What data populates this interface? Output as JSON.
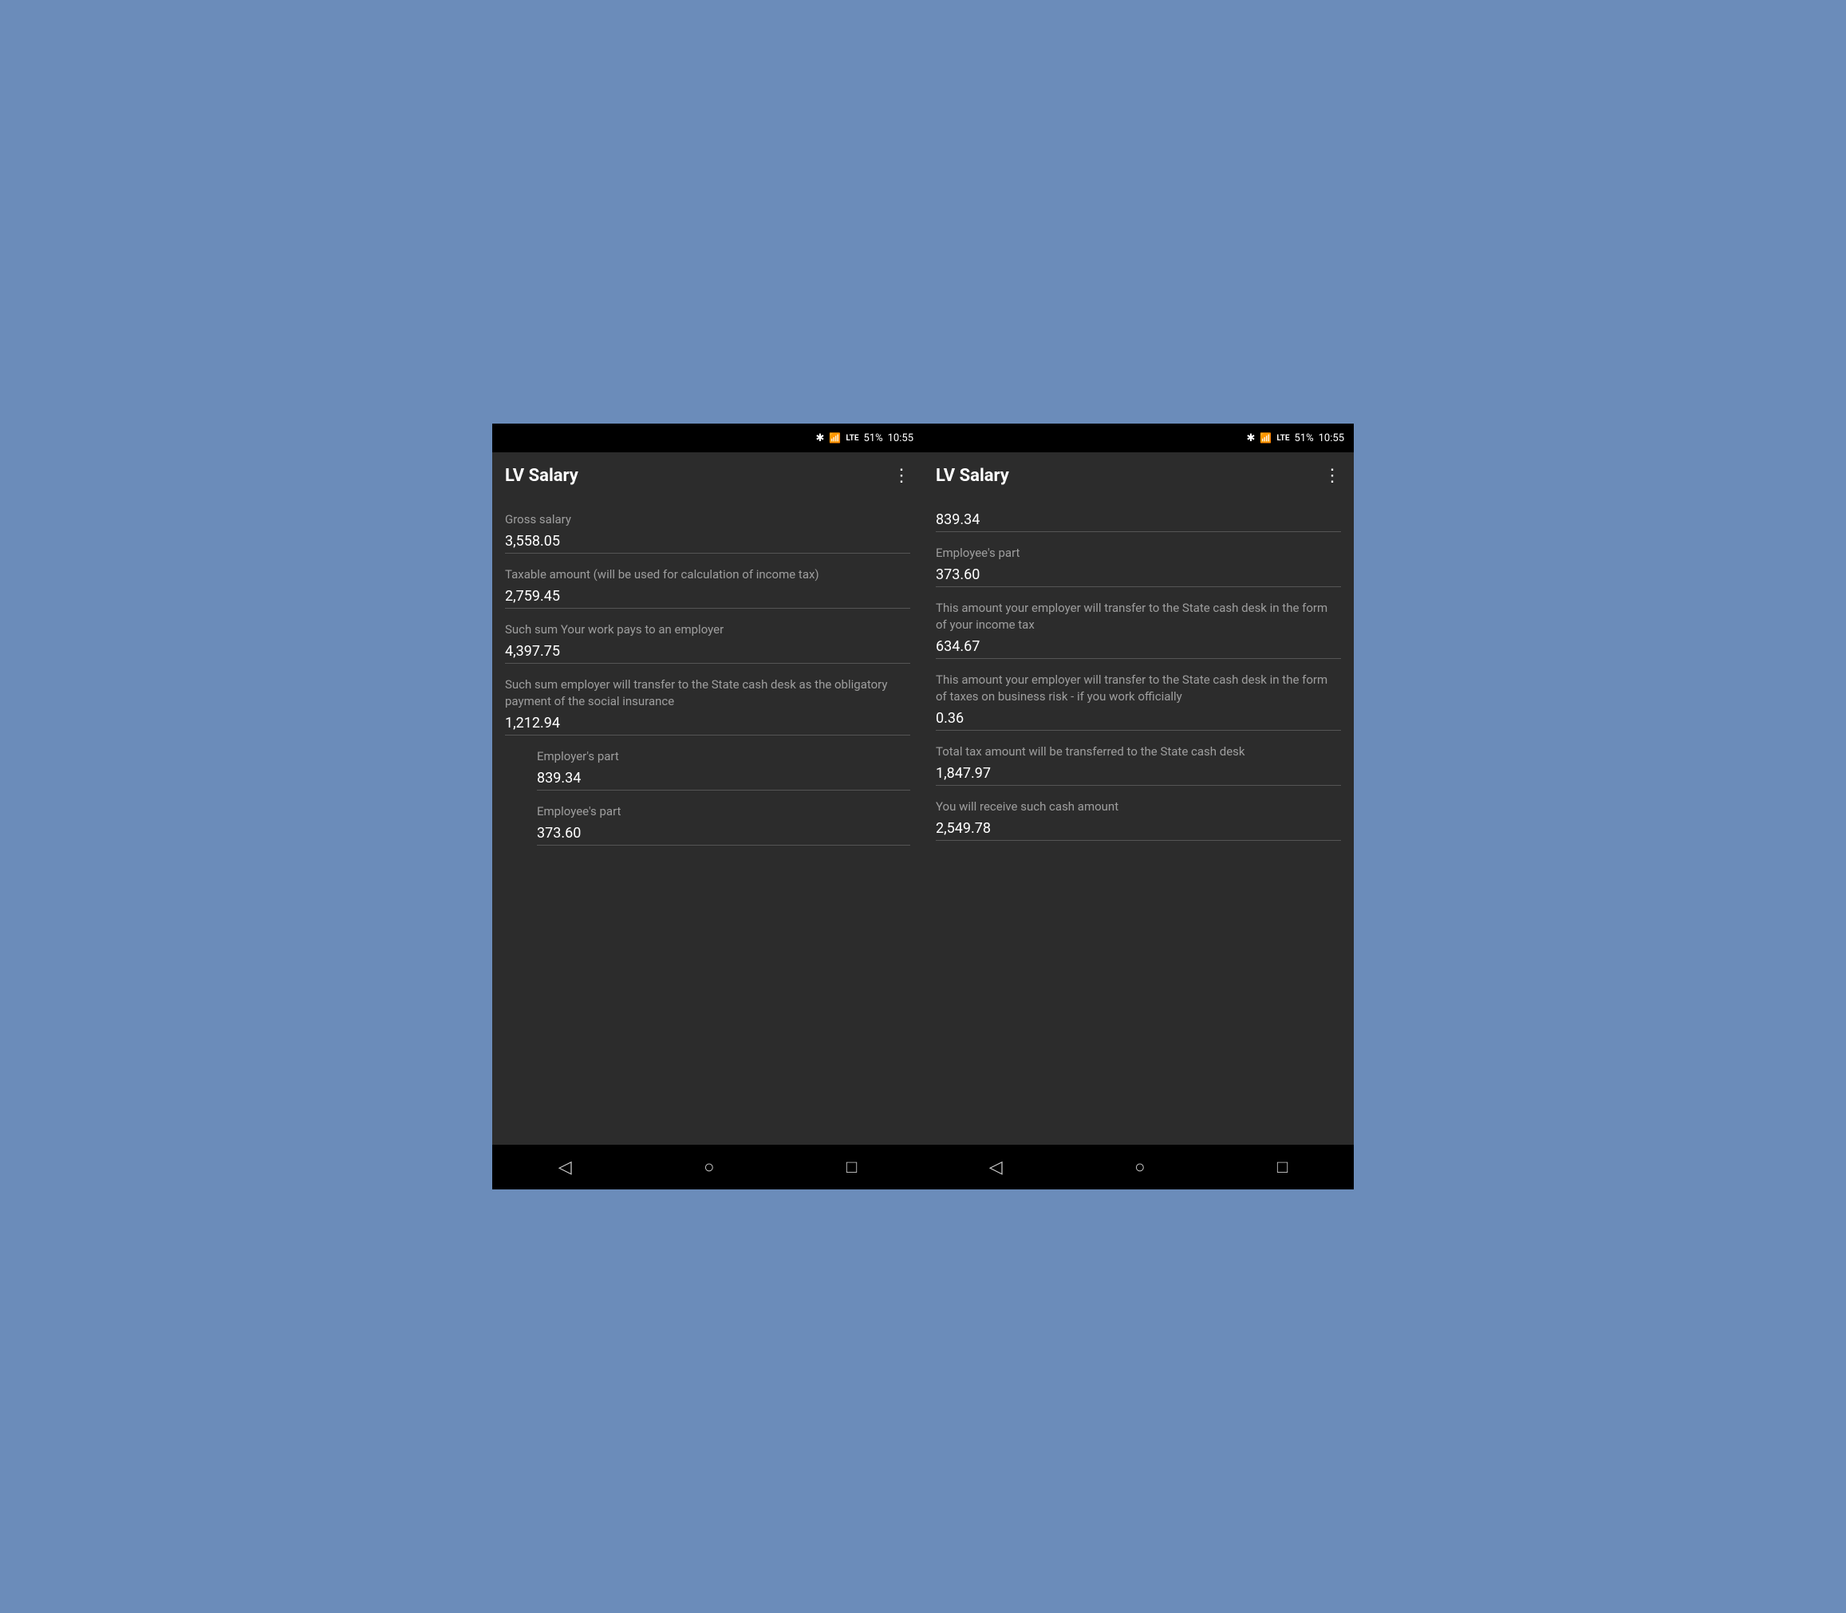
{
  "phones": [
    {
      "id": "left",
      "statusBar": {
        "battery": "51%",
        "time": "10:55"
      },
      "appBar": {
        "title": "LV Salary",
        "menuIcon": "⋮"
      },
      "fields": [
        {
          "id": "gross-salary",
          "label": "Gross salary",
          "value": "3,558.05",
          "sub": false
        },
        {
          "id": "taxable-amount",
          "label": "Taxable amount (will be used for calculation of income tax)",
          "value": "2,759.45",
          "sub": false
        },
        {
          "id": "work-pays-employer",
          "label": "Such sum Your work pays to an employer",
          "value": "4,397.75",
          "sub": false
        },
        {
          "id": "social-insurance",
          "label": "Such sum employer will transfer to the State cash desk as the obligatory payment of the social insurance",
          "value": "1,212.94",
          "sub": false
        },
        {
          "id": "employers-part",
          "label": "Employer's part",
          "value": "839.34",
          "sub": true
        },
        {
          "id": "employees-part",
          "label": "Employee's part",
          "value": "373.60",
          "sub": true
        }
      ],
      "nav": {
        "back": "◁",
        "home": "○",
        "recents": "□"
      }
    },
    {
      "id": "right",
      "statusBar": {
        "battery": "51%",
        "time": "10:55"
      },
      "appBar": {
        "title": "LV Salary",
        "menuIcon": "⋮"
      },
      "partialValue": "839.34",
      "fields": [
        {
          "id": "employees-part-top",
          "label": "Employee's part",
          "value": "373.60",
          "sub": false
        },
        {
          "id": "income-tax",
          "label": "This amount your employer will transfer to the State cash desk in the form of your income tax",
          "value": "634.67",
          "sub": false
        },
        {
          "id": "business-risk",
          "label": "This amount your employer will transfer to the State cash desk in the form of taxes on business risk - if you work officially",
          "value": "0.36",
          "sub": false
        },
        {
          "id": "total-tax",
          "label": "Total tax amount will be transferred to the State cash desk",
          "value": "1,847.97",
          "sub": false
        },
        {
          "id": "cash-amount",
          "label": "You will receive such cash amount",
          "value": "2,549.78",
          "sub": false
        }
      ],
      "nav": {
        "back": "◁",
        "home": "○",
        "recents": "□"
      }
    }
  ]
}
